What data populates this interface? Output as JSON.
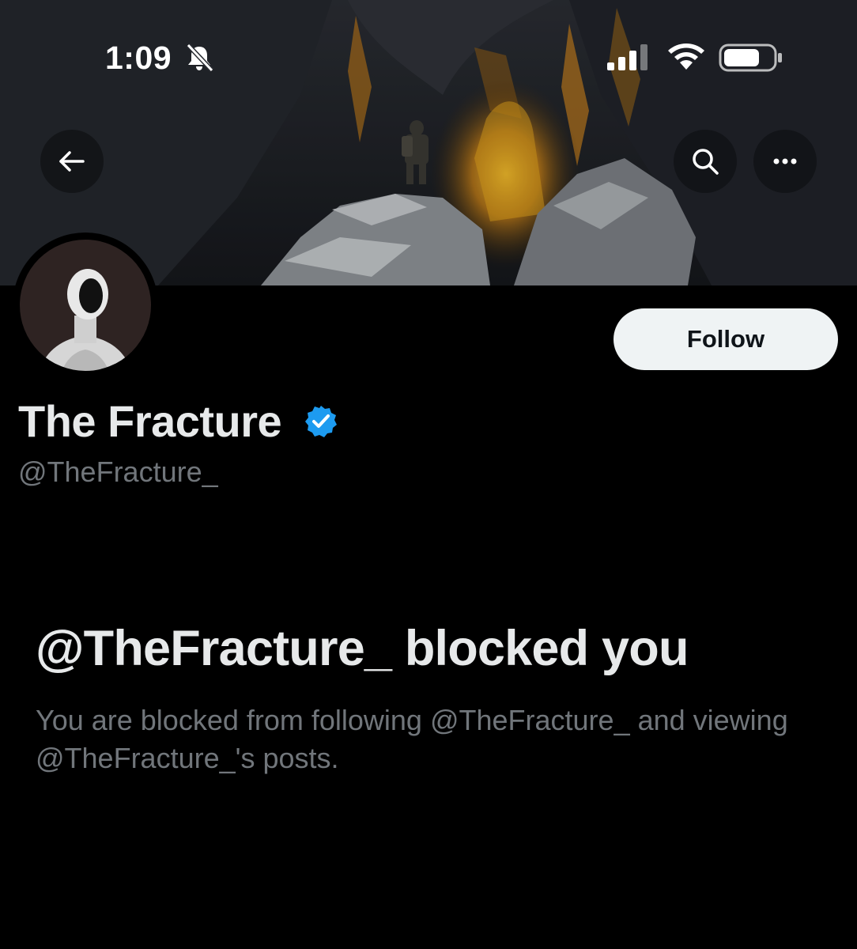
{
  "status_bar": {
    "time": "1:09",
    "icons": [
      "bell-muted-icon",
      "cellular-signal-icon",
      "wifi-icon",
      "battery-icon"
    ]
  },
  "header": {
    "buttons": [
      "back-arrow-icon",
      "search-icon",
      "more-icon"
    ]
  },
  "profile": {
    "display_name": "The Fracture",
    "handle": "@TheFracture_",
    "verified": true,
    "follow_label": "Follow"
  },
  "blocked": {
    "title": "@TheFracture_ blocked you",
    "description": "You are blocked from following @TheFracture_ and viewing @TheFracture_'s posts."
  },
  "colors": {
    "background": "#000000",
    "primary_text": "#e7e9ea",
    "secondary_text": "#71767b",
    "verified_blue": "#1d9bf0",
    "follow_button_bg": "#eff3f4"
  }
}
